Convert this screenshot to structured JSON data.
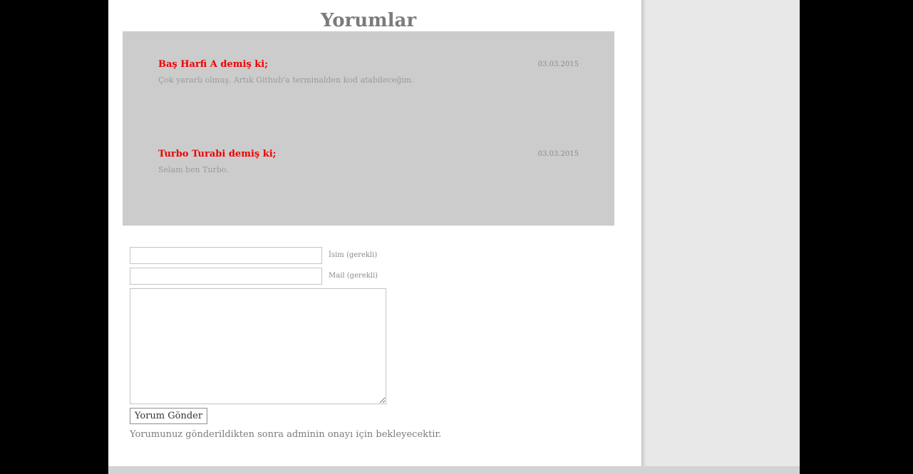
{
  "comments_section": {
    "title": "Yorumlar",
    "comments": [
      {
        "author_line": "Baş Harfi A demiş ki;",
        "date": "03.03.2015",
        "text": "Çok yararlı olmuş. Artık Github'a terminalden kod atabileceğim."
      },
      {
        "author_line": "Turbo Turabi demiş ki;",
        "date": "03.03.2015",
        "text": "Selam ben Turbo."
      }
    ]
  },
  "comment_form": {
    "name_value": "",
    "name_label": "İsim (gerekli)",
    "mail_value": "",
    "mail_label": "Mail (gerekli)",
    "message_value": "",
    "submit_label": "Yorum Gönder",
    "moderation_note": "Yorumunuz gönderildikten sonra adminin onayı için bekleyecektir."
  },
  "colors": {
    "comment_author": "#ee0000",
    "comments_background": "#cccccc",
    "title": "#7b7b7b",
    "sidebar": "#e8e8e8",
    "outer_background": "#000000"
  }
}
